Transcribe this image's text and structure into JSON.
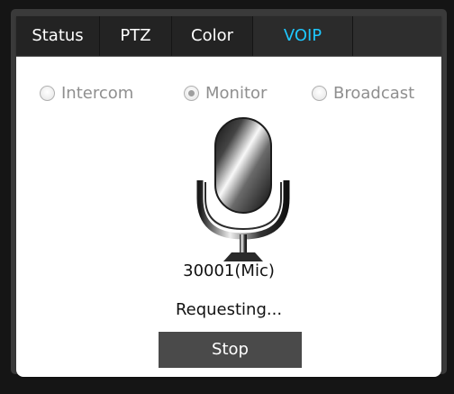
{
  "tabs": [
    {
      "label": "Status"
    },
    {
      "label": "PTZ"
    },
    {
      "label": "Color"
    },
    {
      "label": "VOIP",
      "active": true
    }
  ],
  "modes": [
    {
      "label": "Intercom",
      "checked": false
    },
    {
      "label": "Monitor",
      "checked": true
    },
    {
      "label": "Broadcast",
      "checked": false
    }
  ],
  "mic": {
    "label": "30001(Mic)",
    "icon": "microphone-icon"
  },
  "status_text": "Requesting...",
  "stop_label": "Stop",
  "colors": {
    "active_tab": "#1ec7ff",
    "tab_bg": "#232323",
    "button_bg": "#4a4a4a"
  }
}
